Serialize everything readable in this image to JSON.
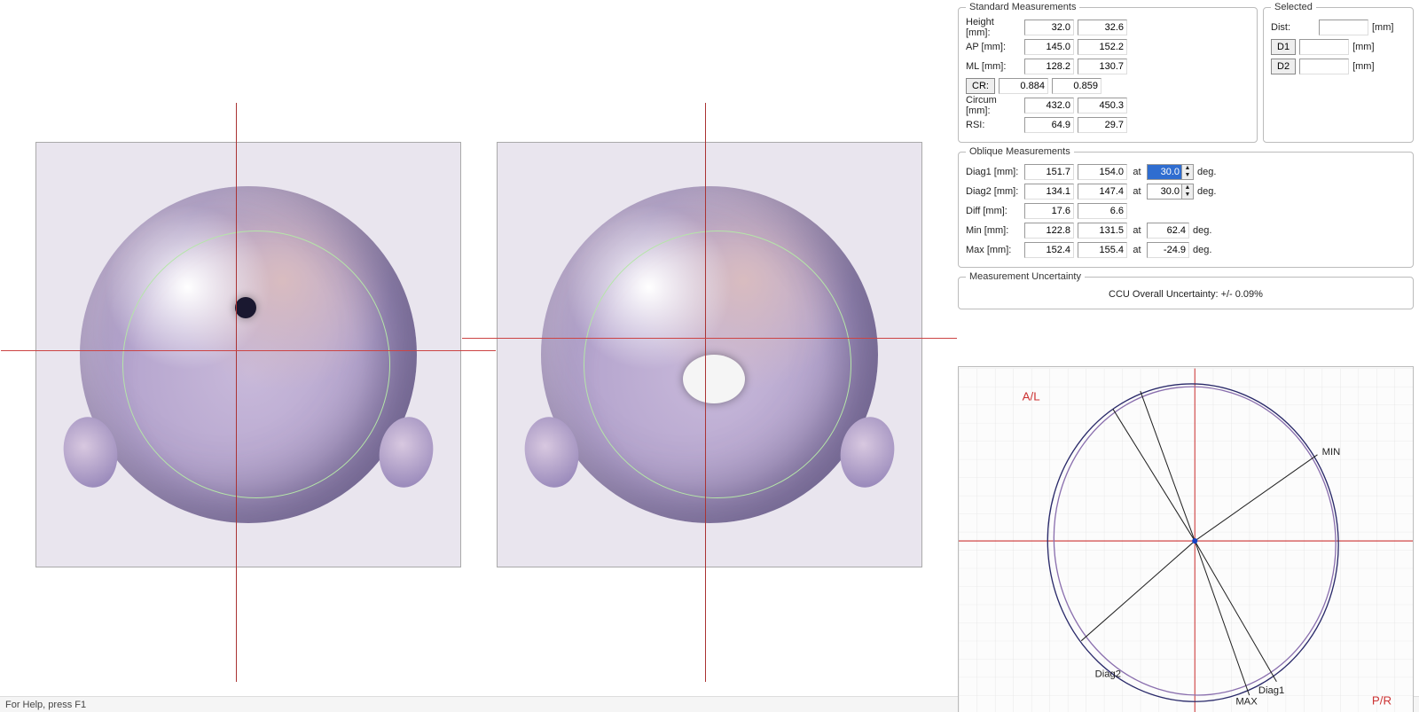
{
  "status_text": "For Help, press F1",
  "groups": {
    "standard": "Standard Measurements",
    "selected": "Selected",
    "oblique": "Oblique Measurements",
    "uncertainty": "Measurement Uncertainty"
  },
  "labels": {
    "height": "Height  [mm]:",
    "ap": "AP  [mm]:",
    "ml": "ML  [mm]:",
    "cr": "CR:",
    "circum": "Circum  [mm]:",
    "rsi": "RSI:",
    "dist": "Dist:",
    "d1": "D1",
    "d2": "D2",
    "mm": "[mm]",
    "diag1": "Diag1  [mm]:",
    "diag2": "Diag2  [mm]:",
    "diff": "Diff  [mm]:",
    "min": "Min  [mm]:",
    "max": "Max  [mm]:",
    "at": "at",
    "deg": "deg."
  },
  "standard": {
    "height": {
      "a": "32.0",
      "b": "32.6"
    },
    "ap": {
      "a": "145.0",
      "b": "152.2"
    },
    "ml": {
      "a": "128.2",
      "b": "130.7"
    },
    "cr": {
      "a": "0.884",
      "b": "0.859"
    },
    "circum": {
      "a": "432.0",
      "b": "450.3"
    },
    "rsi": {
      "a": "64.9",
      "b": "29.7"
    }
  },
  "selected": {
    "dist": "",
    "d1": "",
    "d2": ""
  },
  "oblique": {
    "diag1": {
      "a": "151.7",
      "b": "154.0",
      "angle": "30.0"
    },
    "diag2": {
      "a": "134.1",
      "b": "147.4",
      "angle": "30.0"
    },
    "diff": {
      "a": "17.6",
      "b": "6.6"
    },
    "min": {
      "a": "122.8",
      "b": "131.5",
      "angle": "62.4"
    },
    "max": {
      "a": "152.4",
      "b": "155.4",
      "angle": "-24.9"
    }
  },
  "uncertainty_text": "CCU Overall Uncertainty: +/- 0.09%",
  "plot": {
    "tl": "A/L",
    "br": "P/R",
    "tag_min": "MIN",
    "tag_max": "MAX",
    "tag_d1": "Diag1",
    "tag_d2": "Diag2"
  }
}
